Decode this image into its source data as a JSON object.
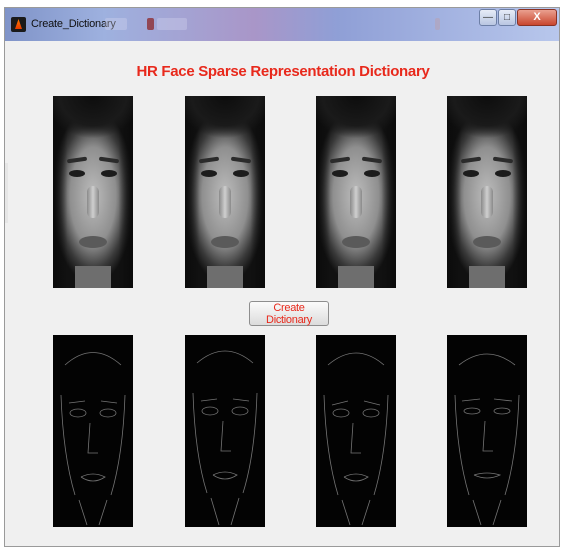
{
  "window": {
    "title": "Create_Dictionary",
    "controls": {
      "minimize_icon": "minimize-icon",
      "maximize_icon": "maximize-icon",
      "close_label": "X"
    }
  },
  "main": {
    "heading": "HR Face Sparse Representation Dictionary",
    "create_button_label": "Create Dictionary"
  },
  "colors": {
    "heading": "#e8291c",
    "button_text": "#e8291c",
    "background": "#f0f0f0"
  }
}
